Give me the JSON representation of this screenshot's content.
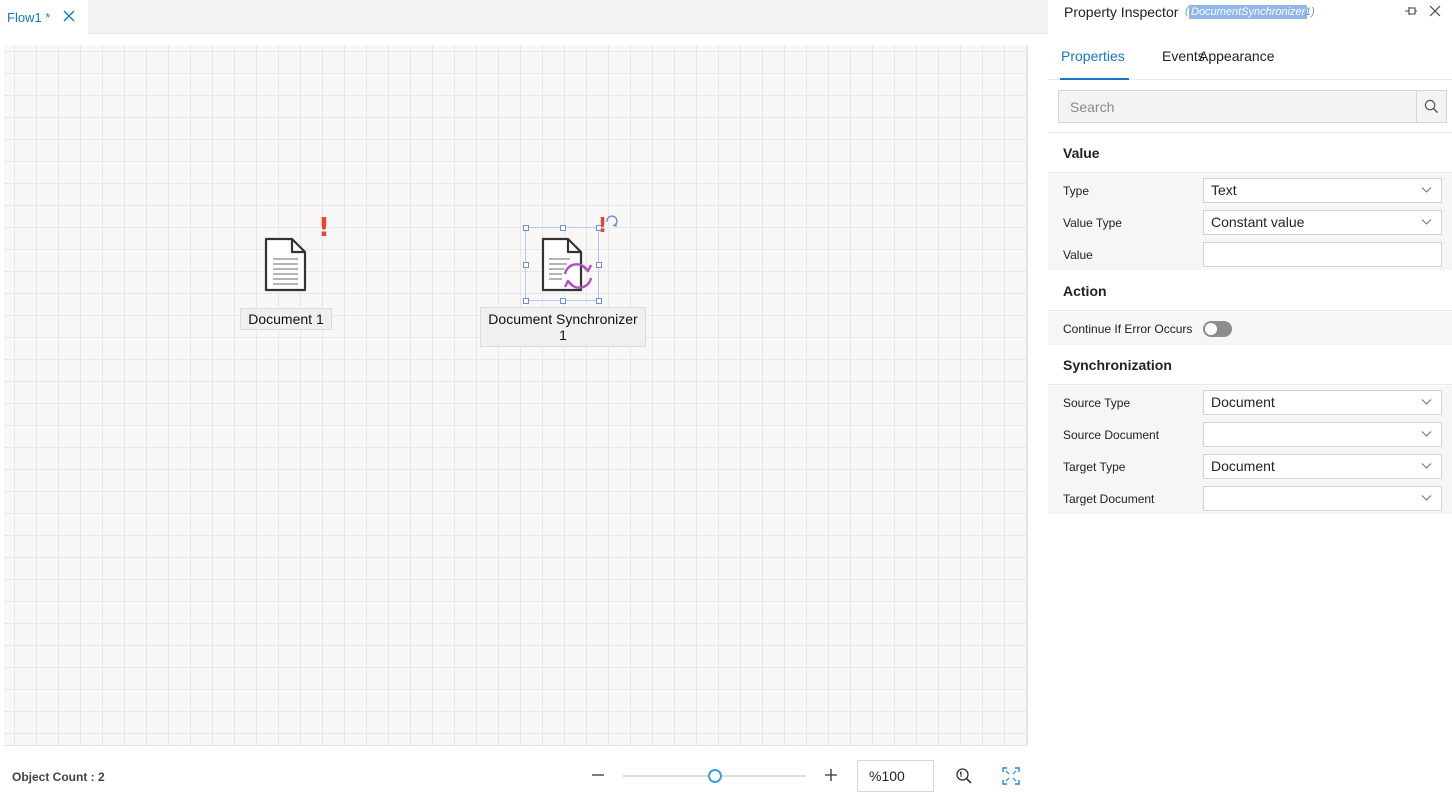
{
  "tab": {
    "label": "Flow1 *"
  },
  "canvas": {
    "nodes": [
      {
        "label": "Document 1",
        "error_mark": "!"
      },
      {
        "label_line1": "Document Synchronizer",
        "label_line2": "1",
        "error_mark": "!"
      }
    ]
  },
  "statusbar": {
    "object_count": "Object Count : 2",
    "zoom_level": "%100",
    "zoom_fraction": 0.5
  },
  "inspector": {
    "title": "Property Inspector",
    "subtitle_selected": "DocumentSynchronizer",
    "subtitle_tail": "1)",
    "subtitle_open": "(",
    "tabs": {
      "properties": "Properties",
      "events": "Events",
      "appearance": "Appearance"
    },
    "search": {
      "placeholder": "Search"
    },
    "sections": {
      "value": {
        "title": "Value",
        "type_label": "Type",
        "type_value": "Text",
        "value_type_label": "Value Type",
        "value_type_value": "Constant value",
        "value_label": "Value",
        "value_value": ""
      },
      "action": {
        "title": "Action",
        "continue_label": "Continue If Error Occurs",
        "continue_on": false
      },
      "synchronization": {
        "title": "Synchronization",
        "source_type_label": "Source Type",
        "source_type_value": "Document",
        "source_document_label": "Source Document",
        "source_document_value": "",
        "target_type_label": "Target Type",
        "target_type_value": "Document",
        "target_document_label": "Target Document",
        "target_document_value": ""
      }
    }
  },
  "colors": {
    "accent": "#1677c9",
    "error": "#e8442e",
    "sync": "#b14fc3"
  }
}
